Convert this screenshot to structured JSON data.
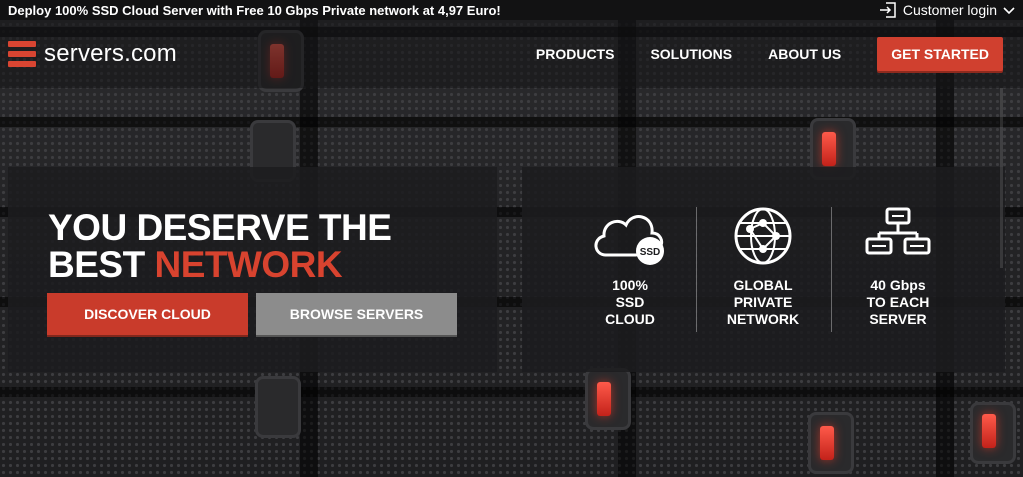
{
  "topbar": {
    "promo": "Deploy 100% SSD Cloud Server with Free 10 Gbps Private network at 4,97 Euro!",
    "login_label": "Customer login",
    "login_icon": "login-icon",
    "chevron_icon": "chevron-down-icon"
  },
  "header": {
    "logo_text": "servers.com",
    "nav": [
      {
        "label": "PRODUCTS"
      },
      {
        "label": "SOLUTIONS"
      },
      {
        "label": "ABOUT US"
      }
    ],
    "cta_label": "GET STARTED"
  },
  "hero": {
    "title_line1": "YOU DESERVE THE",
    "title_line2_prefix": "BEST ",
    "title_line2_accent": "NETWORK",
    "primary_button": "DISCOVER CLOUD",
    "secondary_button": "BROWSE SERVERS"
  },
  "features": [
    {
      "icon": "cloud-ssd-icon",
      "icon_badge": "SSD",
      "label": "100%\nSSD\nCLOUD"
    },
    {
      "icon": "globe-network-icon",
      "label": "GLOBAL\nPRIVATE\nNETWORK"
    },
    {
      "icon": "server-tree-icon",
      "label": "40 Gbps\nTO EACH\nSERVER"
    }
  ],
  "colors": {
    "accent": "#d0402f",
    "secondary_button": "#8c8c8c",
    "topbar_bg": "#121213"
  }
}
